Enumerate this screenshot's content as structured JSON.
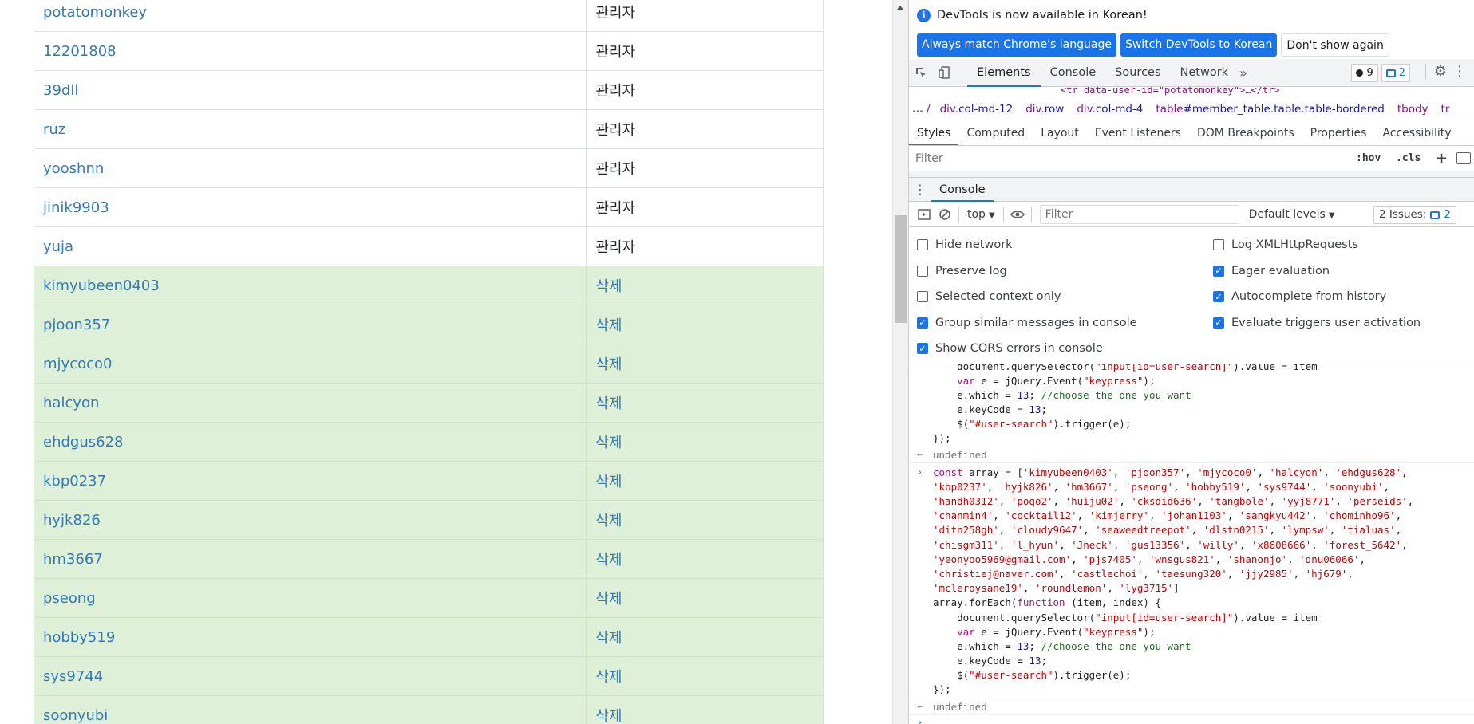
{
  "page": {
    "rows": [
      {
        "user": "potatomonkey",
        "action": "관리자",
        "kind": "admin"
      },
      {
        "user": "12201808",
        "action": "관리자",
        "kind": "admin"
      },
      {
        "user": "39dll",
        "action": "관리자",
        "kind": "admin"
      },
      {
        "user": "ruz",
        "action": "관리자",
        "kind": "admin"
      },
      {
        "user": "yooshnn",
        "action": "관리자",
        "kind": "admin"
      },
      {
        "user": "jinik9903",
        "action": "관리자",
        "kind": "admin"
      },
      {
        "user": "yuja",
        "action": "관리자",
        "kind": "admin"
      },
      {
        "user": "kimyubeen0403",
        "action": "삭제",
        "kind": "delete"
      },
      {
        "user": "pjoon357",
        "action": "삭제",
        "kind": "delete"
      },
      {
        "user": "mjycoco0",
        "action": "삭제",
        "kind": "delete"
      },
      {
        "user": "halcyon",
        "action": "삭제",
        "kind": "delete"
      },
      {
        "user": "ehdgus628",
        "action": "삭제",
        "kind": "delete"
      },
      {
        "user": "kbp0237",
        "action": "삭제",
        "kind": "delete"
      },
      {
        "user": "hyjk826",
        "action": "삭제",
        "kind": "delete"
      },
      {
        "user": "hm3667",
        "action": "삭제",
        "kind": "delete"
      },
      {
        "user": "pseong",
        "action": "삭제",
        "kind": "delete"
      },
      {
        "user": "hobby519",
        "action": "삭제",
        "kind": "delete"
      },
      {
        "user": "sys9744",
        "action": "삭제",
        "kind": "delete"
      },
      {
        "user": "soonyubi",
        "action": "삭제",
        "kind": "delete"
      }
    ]
  },
  "devtools": {
    "infobar": {
      "message": "DevTools is now available in Korean!",
      "btn_match": "Always match Chrome's language",
      "btn_switch": "Switch DevTools to Korean",
      "btn_dismiss": "Don't show again"
    },
    "main_tabs": [
      "Elements",
      "Console",
      "Sources",
      "Network"
    ],
    "active_main_tab": "Elements",
    "counters": {
      "errors": "9",
      "messages": "2"
    },
    "dom_peek": "<tr data-user-id=\"potatomonkey\">…</tr>",
    "breadcrumbs": [
      {
        "tag": "div",
        "cls": ".col-md-12"
      },
      {
        "tag": "div",
        "cls": ".row"
      },
      {
        "tag": "div",
        "cls": ".col-md-4"
      },
      {
        "tag": "table",
        "cls": "#member_table.table.table-bordered"
      },
      {
        "tag": "tbody",
        "cls": ""
      },
      {
        "tag": "tr",
        "cls": ""
      }
    ],
    "crumb_lead": "/",
    "sub_tabs": [
      "Styles",
      "Computed",
      "Layout",
      "Event Listeners",
      "DOM Breakpoints",
      "Properties",
      "Accessibility"
    ],
    "styles_filter_placeholder": "Filter",
    "hov_label": ":hov",
    "cls_label": ".cls",
    "drawer_tab": "Console",
    "console_toolbar": {
      "context": "top",
      "filter_placeholder": "Filter",
      "levels": "Default levels",
      "issues_label": "2 Issues:",
      "issues_count": "2"
    },
    "settings": [
      {
        "label": "Hide network",
        "checked": false
      },
      {
        "label": "Log XMLHttpRequests",
        "checked": false
      },
      {
        "label": "Preserve log",
        "checked": false
      },
      {
        "label": "Eager evaluation",
        "checked": true
      },
      {
        "label": "Selected context only",
        "checked": false
      },
      {
        "label": "Autocomplete from history",
        "checked": true
      },
      {
        "label": "Group similar messages in console",
        "checked": true
      },
      {
        "label": "Evaluate triggers user activation",
        "checked": true
      },
      {
        "label": "Show CORS errors in console",
        "checked": true
      }
    ],
    "console": {
      "top_partial": [
        "    document.querySelector(\"input[id=user-search]\").value = item",
        "    var e = jQuery.Event(\"keypress\");",
        "    e.which = 13; //choose the one you want",
        "    e.keyCode = 13;",
        "    $(\"#user-search\").trigger(e);",
        "});"
      ],
      "result1": "undefined",
      "input_lines": [
        "const array = ['kimyubeen0403', 'pjoon357', 'mjycoco0', 'halcyon', 'ehdgus628',",
        "'kbp0237', 'hyjk826', 'hm3667', 'pseong', 'hobby519', 'sys9744', 'soonyubi',",
        "'handh0312', 'poqo2', 'huiju02', 'cksdid636', 'tangbole', 'yyj8771', 'perseids',",
        "'chanmin4', 'cocktail12', 'kimjerry', 'johan1103', 'sangkyu442', 'chominho96',",
        "'ditn258gh', 'cloudy9647', 'seaweedtreepot', 'dlstn0215', 'lympsw', 'tialuas',",
        "'chisgm311', 'l_hyun', 'Jneck', 'gus13356', 'willy', 'x8608666', 'forest_5642',",
        "'yeonyoo5969@gmail.com', 'pjs7405', 'wnsgus821', 'shanonjo', 'dnu06066',",
        "'christiej@naver.com', 'castlechoi', 'taesung320', 'jjy2985', 'hj679',",
        "'mcleroysane19', 'roundlemon', 'lyg3715']",
        "array.forEach(function (item, index) {",
        "    document.querySelector(\"input[id=user-search]\").value = item",
        "    var e = jQuery.Event(\"keypress\");",
        "    e.which = 13; //choose the one you want",
        "    e.keyCode = 13;",
        "    $(\"#user-search\").trigger(e);",
        "});"
      ],
      "result2": "undefined"
    }
  },
  "icons": {
    "info": "info-icon",
    "inspect": "inspect-element-icon",
    "device": "device-toolbar-icon",
    "more_tabs": "more-tabs-icon",
    "settings": "gear-icon",
    "menu": "kebab-menu-icon",
    "sidebar": "sidebar-icon",
    "new_style_rule": "new-style-rule-icon",
    "run": "sidebar-toggle-icon",
    "clear": "clear-console-icon",
    "eye": "live-expression-icon"
  },
  "colors": {
    "link": "#337ab7",
    "delete_row_bg": "#dff0d8",
    "devtools_accent": "#1a73e8"
  }
}
